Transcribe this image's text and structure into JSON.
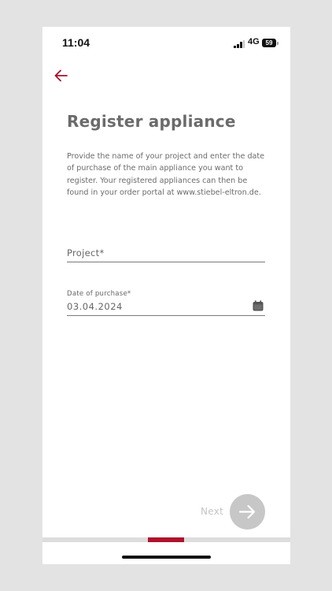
{
  "status_bar": {
    "time": "11:04",
    "network": "4G",
    "battery": "59"
  },
  "header": {
    "back_icon": "arrow-left-icon",
    "back_color": "#a8112b"
  },
  "main": {
    "title": "Register appliance",
    "description": "Provide the name of your project and enter the date of purchase of the main appliance you want to register. Your registered appliances can then be found in your order portal at www.stiebel-eltron.de.",
    "project_field": {
      "label": "Project*",
      "value": ""
    },
    "date_field": {
      "label": "Date of purchase*",
      "value": "03.04.2024",
      "icon": "calendar-icon"
    }
  },
  "footer": {
    "next_label": "Next",
    "next_icon": "arrow-right-icon",
    "step_progress": {
      "current": 2,
      "total": 7
    },
    "accent_color": "#b0102c"
  }
}
